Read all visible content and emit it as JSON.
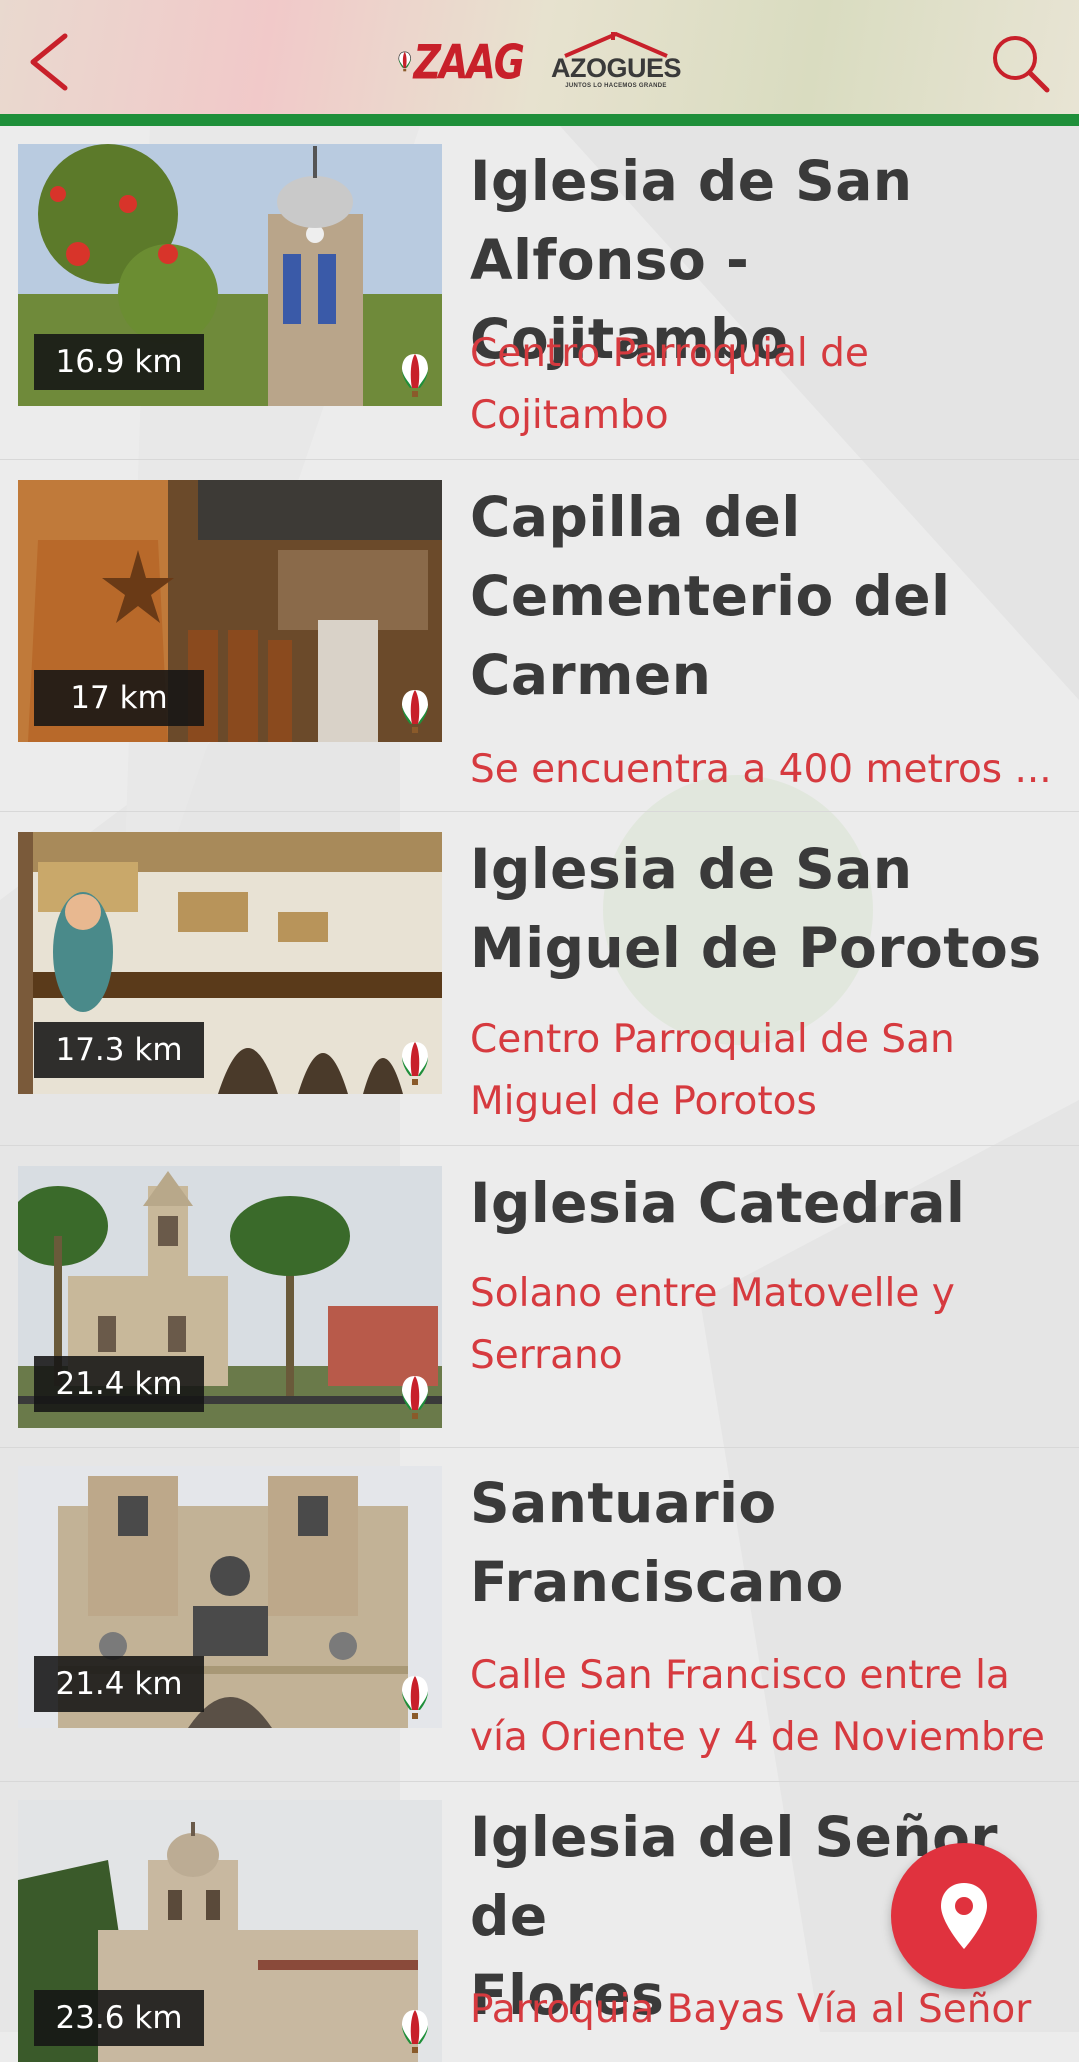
{
  "header": {
    "logo_zaag": "ZAAG",
    "logo_azogues": "AZOGUES",
    "logo_azogues_tagline": "JUNTOS LO HACEMOS GRANDE"
  },
  "places": [
    {
      "distance": "16.9 km",
      "title_lines": [
        "Iglesia de San",
        "Alfonso - Cojitambo"
      ],
      "subtitle_lines": [
        "Centro Parroquial de",
        "Cojitambo"
      ]
    },
    {
      "distance": "17 km",
      "title_lines": [
        "Capilla del",
        "Cementerio del",
        "Carmen"
      ],
      "subtitle_lines": [
        "Se encuentra a 400 metros ..."
      ]
    },
    {
      "distance": "17.3 km",
      "title_lines": [
        "Iglesia de San",
        "Miguel de Porotos"
      ],
      "subtitle_lines": [
        "Centro Parroquial de San",
        "Miguel de Porotos"
      ]
    },
    {
      "distance": "21.4 km",
      "title_lines": [
        "Iglesia Catedral"
      ],
      "subtitle_lines": [
        "Solano entre  Matovelle y",
        "Serrano"
      ]
    },
    {
      "distance": "21.4 km",
      "title_lines": [
        "Santuario",
        "Franciscano"
      ],
      "subtitle_lines": [
        "Calle San Francisco entre la",
        "vía Oriente y 4 de Noviembre"
      ]
    },
    {
      "distance": "23.6 km",
      "title_lines": [
        "Iglesia del Señor de",
        "Flores"
      ],
      "subtitle_lines": [
        "Parroquia Bayas Vía al Señor"
      ]
    }
  ],
  "colors": {
    "accent_red": "#d63a3f",
    "fab_red": "#e0323e",
    "header_green": "#1f8f3a",
    "title_gray": "#3a3a3a"
  },
  "icons": {
    "back": "chevron-left-icon",
    "search": "search-icon",
    "fab": "map-pin-icon",
    "thumb_badge": "balloon-icon"
  }
}
